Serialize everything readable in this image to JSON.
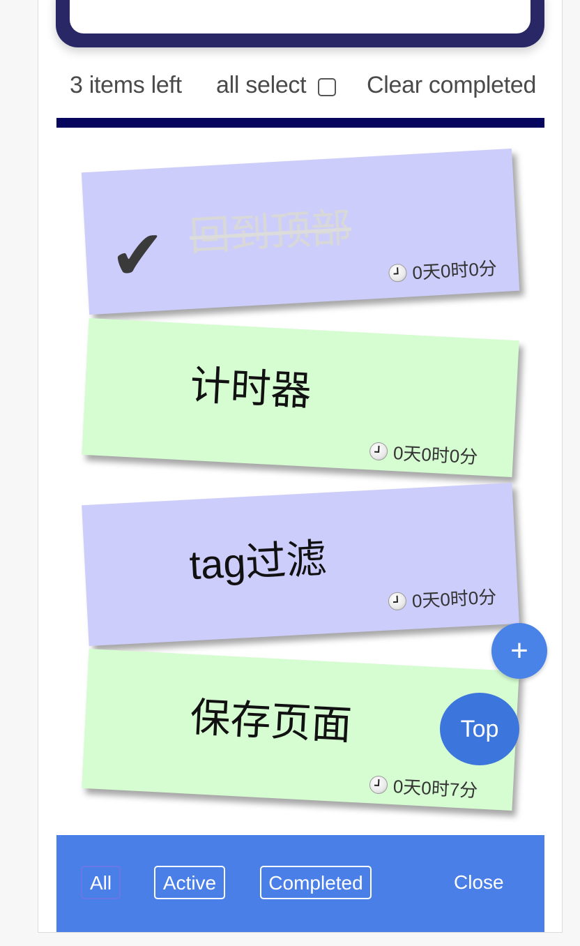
{
  "stats": {
    "items_left": "3 items left",
    "all_select_label": "all select",
    "clear_completed": "Clear completed"
  },
  "todos": [
    {
      "text": "回到顶部",
      "completed": true,
      "color": "blue",
      "time": "0天0时0分"
    },
    {
      "text": "计时器",
      "completed": false,
      "color": "green",
      "time": "0天0时0分"
    },
    {
      "text": "tag过滤",
      "completed": false,
      "color": "blue",
      "time": "0天0时0分"
    },
    {
      "text": "保存页面",
      "completed": false,
      "color": "green",
      "time": "0天0时7分"
    }
  ],
  "icons": {
    "check": "✔",
    "clock": "clock-icon"
  },
  "fab": {
    "add_label": "+",
    "top_label": "Top"
  },
  "footer": {
    "all": "All",
    "active": "Active",
    "completed": "Completed",
    "close": "Close"
  },
  "colors": {
    "note_blue": "#cdcdfb",
    "note_green": "#d6fcd1",
    "footer": "#4a7fe8",
    "divider": "#06065f",
    "input_frame": "#2a2766"
  }
}
